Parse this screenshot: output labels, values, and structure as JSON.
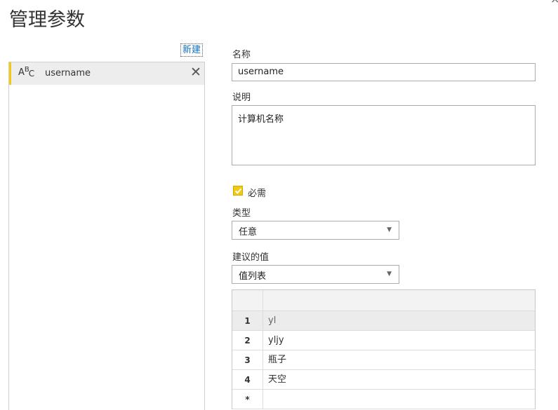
{
  "dialog": {
    "title": "管理参数"
  },
  "sidebar": {
    "new_label": "新建",
    "items": [
      {
        "icon": "abc-text-type-icon",
        "name": "username",
        "selected": true
      }
    ]
  },
  "form": {
    "name_label": "名称",
    "name_value": "username",
    "description_label": "说明",
    "description_value": "计算机名称",
    "required_label": "必需",
    "required_checked": true,
    "type_label": "类型",
    "type_value": "任意",
    "suggested_label": "建议的值",
    "suggested_value": "值列表"
  },
  "values_grid": {
    "rows": [
      {
        "num": "1",
        "value": "yl",
        "selected": true
      },
      {
        "num": "2",
        "value": "yljy"
      },
      {
        "num": "3",
        "value": "瓶子"
      },
      {
        "num": "4",
        "value": "天空"
      },
      {
        "num": "*",
        "value": ""
      }
    ]
  },
  "colors": {
    "accent": "#f2c811",
    "link": "#106ebe"
  }
}
